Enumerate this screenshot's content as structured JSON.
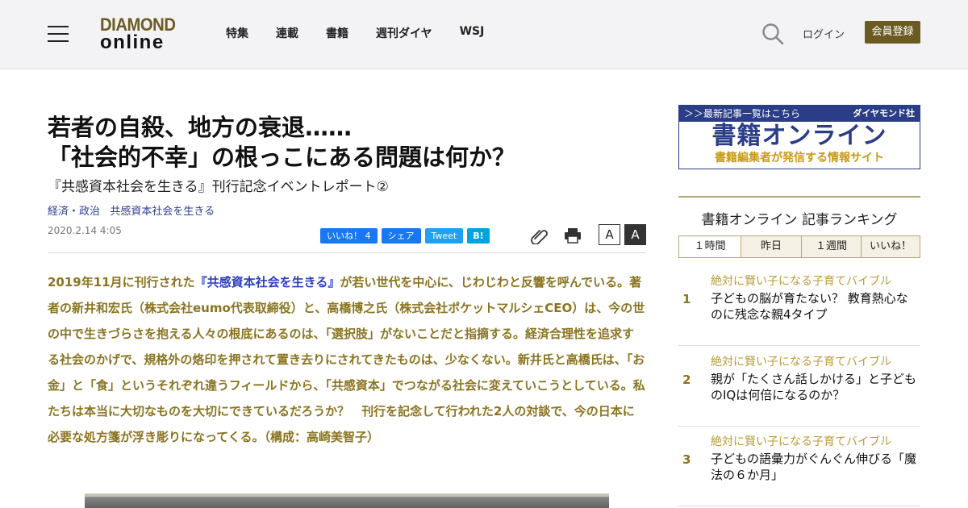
{
  "header": {
    "logo_top": "DIAMOND",
    "logo_bottom": "online",
    "nav": [
      "特集",
      "連載",
      "書籍",
      "週刊ダイヤ",
      "WSJ"
    ],
    "login": "ログイン",
    "signup": "会員登録"
  },
  "article": {
    "title_line1": "若者の自殺、地方の衰退……",
    "title_line2": "「社会的不幸」の根っこにある問題は何か？",
    "subtitle": "『共感資本社会を生きる』刊行記念イベントレポート②",
    "category1": "経済・政治",
    "category_sep": "・",
    "category2": "政治",
    "category3": "共感資本社会を生きる",
    "date": "2020.2.14 4:05",
    "share": {
      "like": "いいね！ 4",
      "share": "シェア",
      "tweet": "Tweet",
      "hatena": "B!"
    },
    "font_small": "A",
    "font_large": "A",
    "lead_pre": "2019年11月に刊行された",
    "lead_link": "『共感資本社会を生きる』",
    "lead_post": "が若い世代を中心に、じわじわと反響を呼んでいる。著者の新井和宏氏（株式会社eumo代表取締役）と、高橋博之氏（株式会社ポケットマルシェCEO）は、今の世の中で生きづらさを抱える人々の根底にあるのは、「選択肢」がないことだと指摘する。経済合理性を追求する社会のかげで、規格外の烙印を押されて置き去りにされてきたものは、少なくない。新井氏と高橋氏は、「お金」と「食」というそれぞれ違うフィールドから、「共感資本」でつながる社会に変えていこうとしている。私たちは本当に大切なものを大切にできているだろうか？　刊行を記念して行われた2人の対談で、今の日本に必要な処方箋が浮き彫りになってくる。（構成：高崎美智子）"
  },
  "sidebar": {
    "banner_top_left": "＞＞最新記事一覧はこちら",
    "banner_top_right": "ダイヤモンド社",
    "banner_main": "書籍オンライン",
    "banner_sub": "書籍編集者が発信する情報サイト",
    "ranking_title": "書籍オンライン 記事ランキング",
    "tabs": [
      "１時間",
      "昨日",
      "１週間",
      "いいね！"
    ],
    "ranking": [
      {
        "num": "1",
        "category": "絶対に賢い子になる子育てバイブル",
        "headline": "子どもの脳が育たない？ 教育熱心なのに残念な親4タイプ"
      },
      {
        "num": "2",
        "category": "絶対に賢い子になる子育てバイブル",
        "headline": "親が「たくさん話しかける」と子どものIQは何倍になるのか？"
      },
      {
        "num": "3",
        "category": "絶対に賢い子になる子育てバイブル",
        "headline": "子どもの語彙力がぐんぐん伸びる「魔法の６か月」"
      }
    ]
  }
}
